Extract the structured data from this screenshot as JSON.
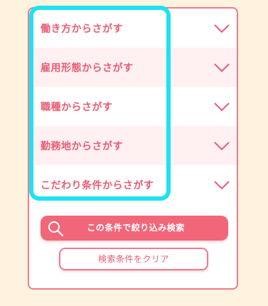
{
  "search_panel": {
    "rows": [
      {
        "label": "働き方からさがす"
      },
      {
        "label": "雇用形態からさがす"
      },
      {
        "label": "職種からさがす"
      },
      {
        "label": "勤務地からさがす"
      },
      {
        "label": "こだわり条件からさがす"
      }
    ],
    "search_button_label": "この条件で絞り込み検索",
    "clear_button_label": "検索条件をクリア"
  },
  "icons": {
    "row_expand": "chevron-down-icon",
    "search": "search-icon"
  },
  "colors": {
    "page_background": "#fdf3df",
    "accent": "#f2667a",
    "label_text": "#e85d75",
    "row_alt_background": "#fff0f2",
    "highlight": "#1ee3ef"
  }
}
